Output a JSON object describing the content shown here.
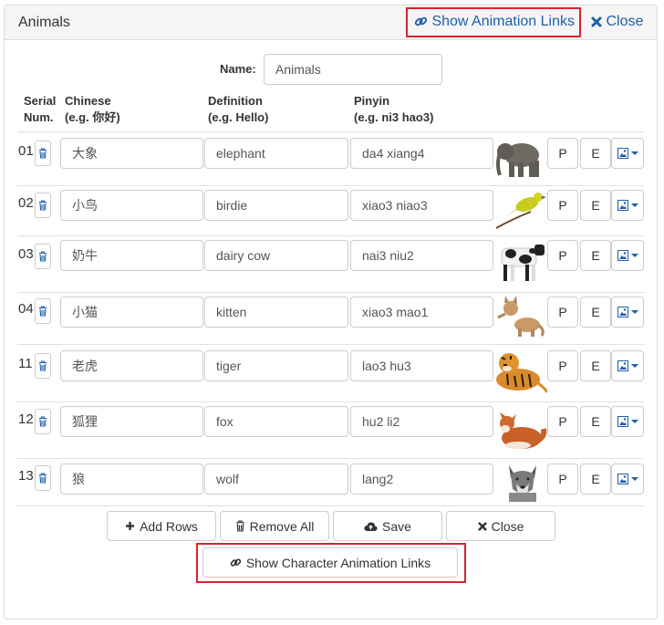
{
  "header": {
    "title": "Animals",
    "show_animation_links": "Show Animation Links",
    "close": "Close"
  },
  "name_field": {
    "label": "Name:",
    "value": "Animals"
  },
  "columns": {
    "serial": [
      "Serial",
      "Num."
    ],
    "chinese": [
      "Chinese",
      "(e.g. 你好)"
    ],
    "definition": [
      "Definition",
      "(e.g. Hello)"
    ],
    "pinyin": [
      "Pinyin",
      "(e.g. ni3 hao3)"
    ]
  },
  "rows": [
    {
      "num": "01",
      "chinese": "大象",
      "definition": "elephant",
      "pinyin": "da4 xiang4",
      "animal_icon": "elephant-icon"
    },
    {
      "num": "02",
      "chinese": "小鸟",
      "definition": "birdie",
      "pinyin": "xiao3 niao3",
      "animal_icon": "bird-icon"
    },
    {
      "num": "03",
      "chinese": "奶牛",
      "definition": "dairy cow",
      "pinyin": "nai3 niu2",
      "animal_icon": "cow-icon"
    },
    {
      "num": "04",
      "chinese": "小猫",
      "definition": "kitten",
      "pinyin": "xiao3 mao1",
      "animal_icon": "kitten-icon"
    },
    {
      "num": "11",
      "chinese": "老虎",
      "definition": "tiger",
      "pinyin": "lao3 hu3",
      "animal_icon": "tiger-icon"
    },
    {
      "num": "12",
      "chinese": "狐狸",
      "definition": "fox",
      "pinyin": "hu2 li2",
      "animal_icon": "fox-icon"
    },
    {
      "num": "13",
      "chinese": "狼",
      "definition": "wolf",
      "pinyin": "lang2",
      "animal_icon": "wolf-icon"
    }
  ],
  "row_buttons": {
    "p": "P",
    "e": "E"
  },
  "footer": {
    "add_rows": "Add Rows",
    "remove_all": "Remove All",
    "save": "Save",
    "close": "Close",
    "show_character_animation_links": "Show Character Animation Links"
  },
  "colors": {
    "link": "#1f5fa8",
    "highlight": "#d9232d",
    "border": "#cccccc"
  }
}
